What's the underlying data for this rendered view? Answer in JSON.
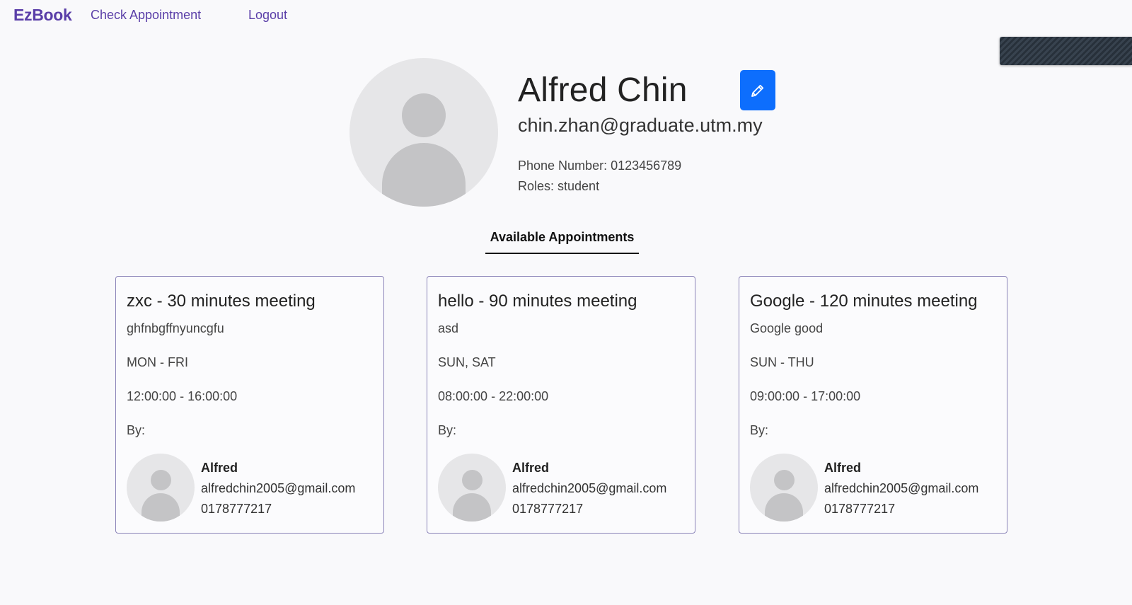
{
  "nav": {
    "brand": "EzBook",
    "links": [
      "Check Appointment",
      "Logout"
    ]
  },
  "profile": {
    "name": "Alfred Chin",
    "email": "chin.zhan@graduate.utm.my",
    "phone": "Phone Number: 0123456789",
    "roles": "Roles: student",
    "avatar_icon": "user-placeholder-icon",
    "edit_icon": "pencil-icon"
  },
  "tabs": {
    "active": "Available Appointments"
  },
  "cards": [
    {
      "title": "zxc - 30 minutes meeting",
      "description": "ghfnbgffnyuncgfu",
      "days": "MON - FRI",
      "time": "12:00:00 - 16:00:00",
      "by_label": "By:",
      "owner": {
        "name": "Alfred",
        "email": "alfredchin2005@gmail.com",
        "phone": "0178777217"
      }
    },
    {
      "title": "hello - 90 minutes meeting",
      "description": "asd",
      "days": "SUN, SAT",
      "time": "08:00:00 - 22:00:00",
      "by_label": "By:",
      "owner": {
        "name": "Alfred",
        "email": "alfredchin2005@gmail.com",
        "phone": "0178777217"
      }
    },
    {
      "title": "Google - 120 minutes meeting",
      "description": "Google good",
      "days": "SUN - THU",
      "time": "09:00:00 - 17:00:00",
      "by_label": "By:",
      "owner": {
        "name": "Alfred",
        "email": "alfredchin2005@gmail.com",
        "phone": "0178777217"
      }
    }
  ],
  "colors": {
    "brand": "#5a3ea8",
    "edit_button": "#0d6efd",
    "card_border": "#8b84b8"
  }
}
